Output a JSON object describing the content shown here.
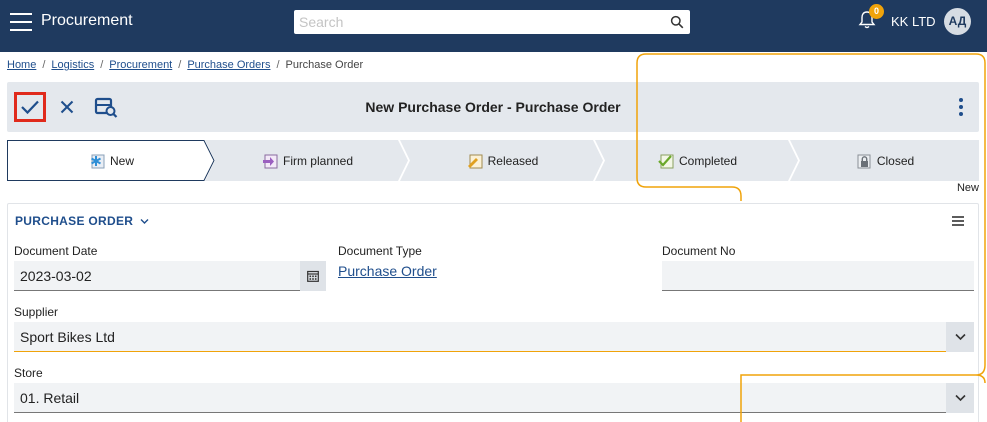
{
  "header": {
    "app_title": "Procurement",
    "search_placeholder": "Search",
    "notification_count": "0",
    "company": "KK LTD",
    "avatar_initials": "АД"
  },
  "breadcrumb": {
    "items": [
      "Home",
      "Logistics",
      "Procurement",
      "Purchase Orders"
    ],
    "current": "Purchase Order"
  },
  "toolbar": {
    "title": "New Purchase Order - Purchase Order"
  },
  "stepper": {
    "steps": [
      "New",
      "Firm planned",
      "Released",
      "Completed",
      "Closed"
    ],
    "active": "New",
    "status_label": "New"
  },
  "form": {
    "section_title": "PURCHASE ORDER",
    "document_date_label": "Document Date",
    "document_date": "2023-03-02",
    "document_type_label": "Document Type",
    "document_type": "Purchase Order",
    "document_no_label": "Document No",
    "document_no": "",
    "supplier_label": "Supplier",
    "supplier": "Sport Bikes Ltd",
    "store_label": "Store",
    "store": "01. Retail"
  },
  "colors": {
    "header_bg": "#1f3a5f",
    "accent_link": "#1f4e8c",
    "highlight_outline": "#e02a1b",
    "overlay_orange": "#f0a30a"
  }
}
